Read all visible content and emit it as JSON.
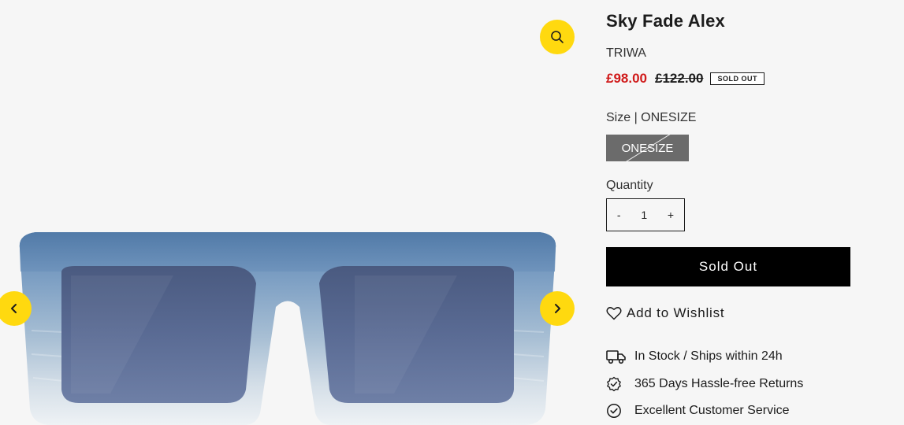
{
  "product": {
    "title": "Sky Fade Alex",
    "vendor": "TRIWA",
    "sale_price": "£98.00",
    "compare_price": "£122.00",
    "badge": "SOLD OUT"
  },
  "size": {
    "label": "Size | ONESIZE",
    "option": "ONESIZE"
  },
  "quantity": {
    "label": "Quantity",
    "minus": "-",
    "value": "1",
    "plus": "+"
  },
  "actions": {
    "sold_out": "Sold Out",
    "wishlist": "Add to Wishlist"
  },
  "features": [
    {
      "icon": "truck-icon",
      "text": "In Stock / Ships within 24h"
    },
    {
      "icon": "badge-check-icon",
      "text": "365 Days Hassle-free Returns"
    },
    {
      "icon": "check-circle-icon",
      "text": "Excellent Customer Service"
    }
  ],
  "colors": {
    "accent_yellow": "#ffd90f",
    "sale_red": "#d01a1a",
    "button_black": "#000000",
    "size_option_gray": "#6b6b6b",
    "frame_blue": "#6f94bd"
  }
}
